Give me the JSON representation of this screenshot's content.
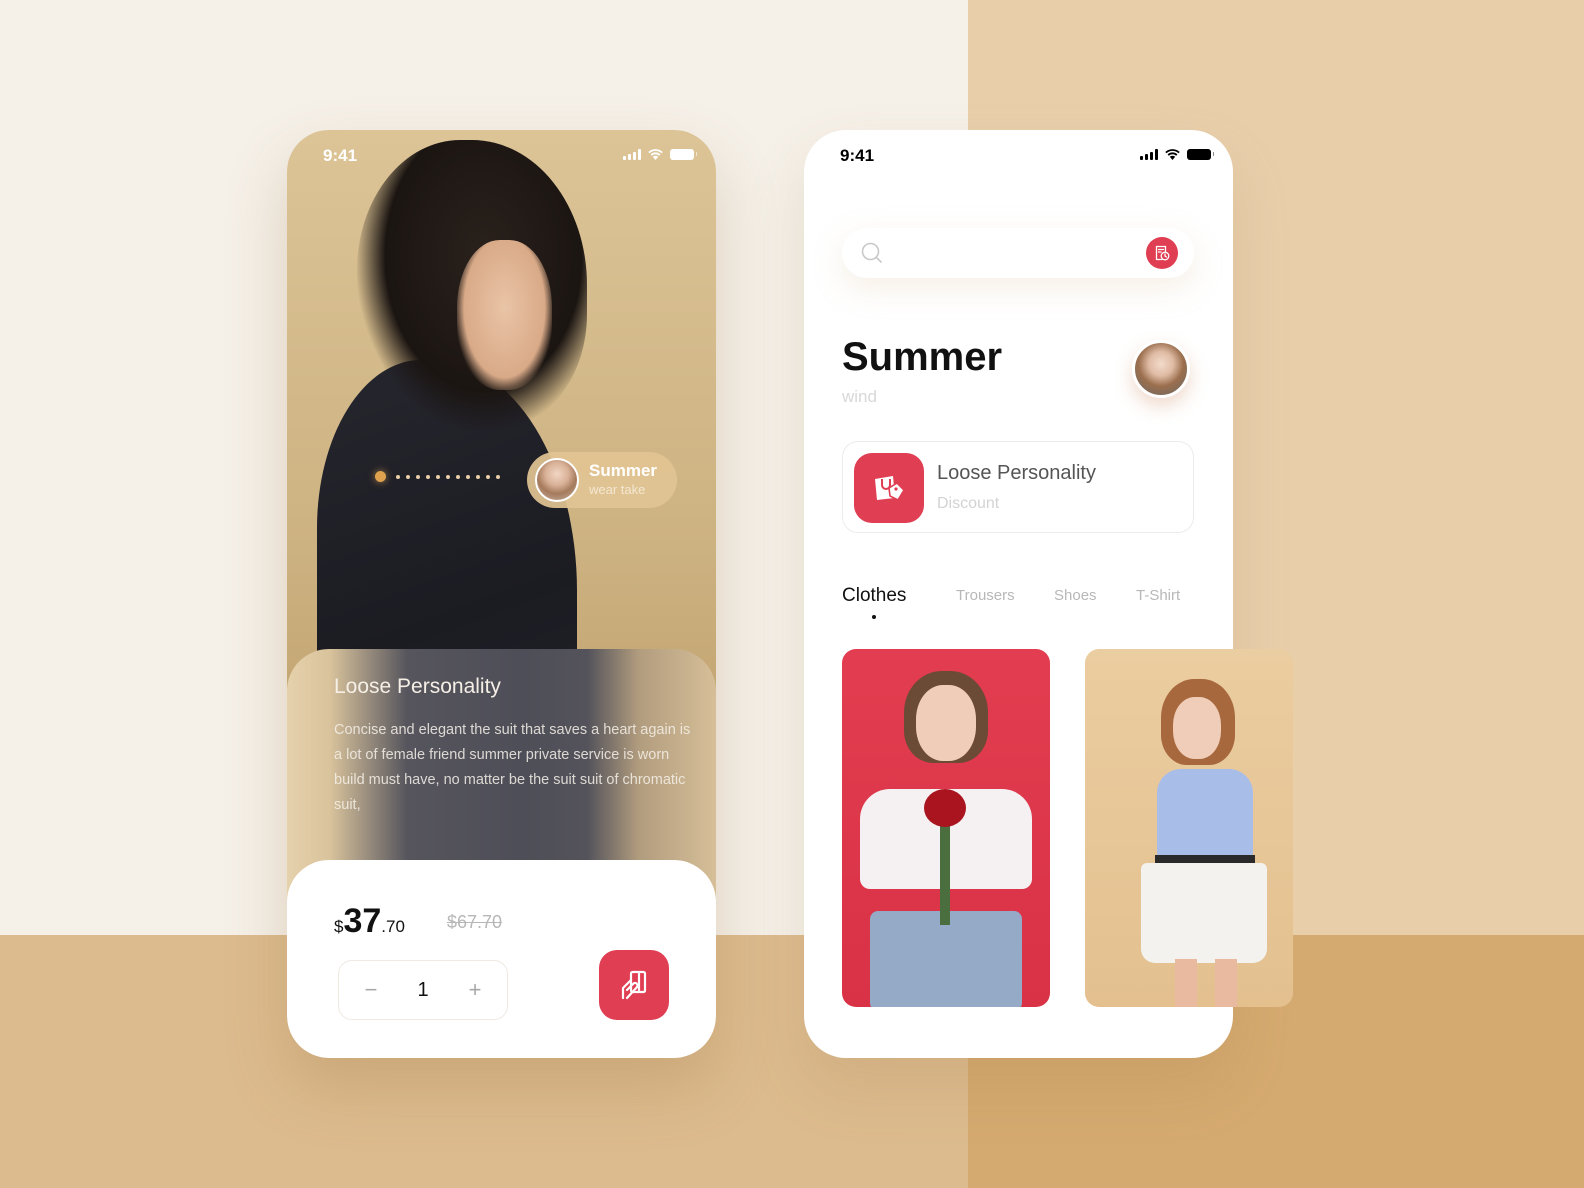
{
  "colors": {
    "accent": "#e03e52",
    "pager_active": "#dea24f",
    "bg_top_left": "#f5f0e8",
    "bg_top_right": "#e8cfaa",
    "bg_bottom_left": "#dcbb8e",
    "bg_bottom_right": "#d5aa70"
  },
  "detail_screen": {
    "status_bar": {
      "time": "9:41",
      "icons": [
        "signal-icon",
        "wifi-icon",
        "battery-icon"
      ]
    },
    "pager": {
      "total": 12,
      "active_index": 0
    },
    "model_chip": {
      "title": "Summer",
      "subtitle": "wear take"
    },
    "info": {
      "title": "Loose Personality",
      "description": "Concise and elegant the suit that saves a heart again is a lot of female friend summer private service is worn build must have, no matter be the suit suit of chromatic suit,"
    },
    "price": {
      "currency": "$",
      "integer": "37",
      "decimal": ".70",
      "original": "$67.70"
    },
    "quantity": {
      "minus_label": "−",
      "value": "1",
      "plus_label": "+"
    },
    "cart_button": {
      "icon": "hand-card-icon"
    }
  },
  "browse_screen": {
    "status_bar": {
      "time": "9:41",
      "icons": [
        "signal-icon",
        "wifi-icon",
        "battery-icon"
      ]
    },
    "search": {
      "placeholder": "",
      "value": "",
      "icon": "search-icon",
      "action_icon": "history-icon"
    },
    "title": "Summer",
    "subtitle": "wind",
    "promo": {
      "title": "Loose Personality",
      "subtitle": "Discount",
      "icon": "shopping-tag-icon"
    },
    "tabs": [
      {
        "label": "Clothes",
        "active": true
      },
      {
        "label": "Trousers",
        "active": false
      },
      {
        "label": "Shoes",
        "active": false
      },
      {
        "label": "T-Shirt",
        "active": false
      }
    ],
    "products": [
      {
        "name": "red-background-white-top-roses"
      },
      {
        "name": "beige-background-blue-tee-pleated-skirt"
      }
    ]
  }
}
